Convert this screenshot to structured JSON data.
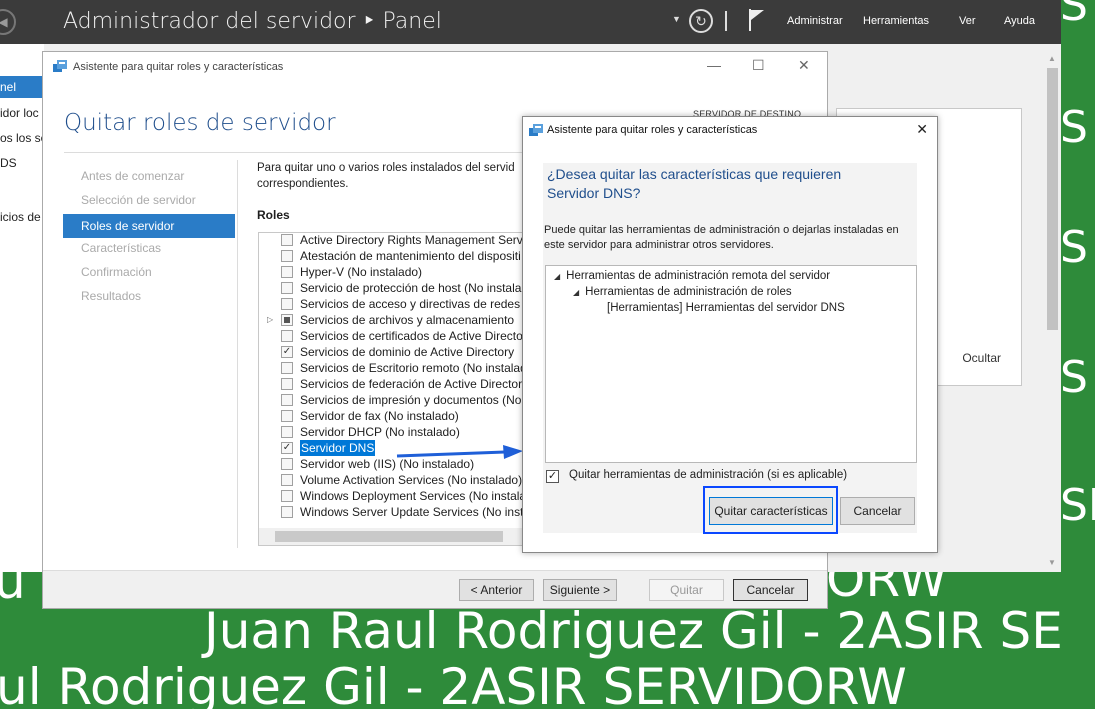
{
  "watermark": {
    "s_letter": "S",
    "se_text": "SE",
    "rw_text": "ORW",
    "ur_text": "u",
    "line1": "Juan Raul Rodriguez Gil - 2ASIR SE",
    "line2": "ul Rodriguez Gil - 2ASIR SERVIDORW"
  },
  "server_manager": {
    "breadcrumb": "Administrador del servidor ‣ Panel",
    "menu": [
      "Administrar",
      "Herramientas",
      "Ver",
      "Ayuda"
    ],
    "left_nav": [
      "nel",
      "idor loc",
      "os los se",
      "DS",
      "",
      "icios de"
    ],
    "tile_hide": "Ocultar"
  },
  "wizard": {
    "title": "Asistente para quitar roles y características",
    "dest_label": "SERVIDOR DE DESTINO",
    "heading": "Quitar roles de servidor",
    "steps": [
      "Antes de comenzar",
      "Selección de servidor",
      "Roles de servidor",
      "Características",
      "Confirmación",
      "Resultados"
    ],
    "intro_line1": "Para quitar uno o varios roles instalados del servid",
    "intro_line2": "correspondientes.",
    "roles_header": "Roles",
    "roles": [
      {
        "label": "Active Directory Rights Management Servi",
        "checked": false
      },
      {
        "label": "Atestación de mantenimiento del dispositi",
        "checked": false
      },
      {
        "label": "Hyper-V (No instalado)",
        "checked": false
      },
      {
        "label": "Servicio de protección de host (No instalad",
        "checked": false
      },
      {
        "label": "Servicios de acceso y directivas de redes (N",
        "checked": false
      },
      {
        "label": "Servicios de archivos y almacenamiento",
        "checked": "partial",
        "expandable": true
      },
      {
        "label": "Servicios de certificados de Active Director",
        "checked": false
      },
      {
        "label": "Servicios de dominio de Active Directory",
        "checked": true
      },
      {
        "label": "Servicios de Escritorio remoto (No instalad",
        "checked": false
      },
      {
        "label": "Servicios de federación de Active Directory",
        "checked": false
      },
      {
        "label": "Servicios de impresión y documentos (No",
        "checked": false
      },
      {
        "label": "Servidor de fax (No instalado)",
        "checked": false
      },
      {
        "label": "Servidor DHCP (No instalado)",
        "checked": false
      },
      {
        "label": "Servidor DNS",
        "checked": true,
        "selected": true
      },
      {
        "label": "Servidor web (IIS) (No instalado)",
        "checked": false
      },
      {
        "label": "Volume Activation Services (No instalado)",
        "checked": false
      },
      {
        "label": "Windows Deployment Services (No instala",
        "checked": false
      },
      {
        "label": "Windows Server Update Services (No insta",
        "checked": false
      }
    ],
    "buttons": {
      "prev": "< Anterior",
      "next": "Siguiente >",
      "remove": "Quitar",
      "cancel": "Cancelar"
    }
  },
  "dialog": {
    "title": "Asistente para quitar roles y características",
    "question": "¿Desea quitar las características que requieren Servidor DNS?",
    "description": "Puede quitar las herramientas de administración o dejarlas instaladas en este servidor para administrar otros servidores.",
    "tree": [
      "Herramientas de administración remota del servidor",
      "Herramientas de administración de roles",
      "[Herramientas] Herramientas del servidor DNS"
    ],
    "checkbox_label": "Quitar herramientas de administración (si es aplicable)",
    "checkbox_checked": true,
    "btn_remove": "Quitar características",
    "btn_cancel": "Cancelar"
  },
  "colors": {
    "desktop": "#2e8b3a",
    "accent": "#2a7cc7",
    "highlight": "#0a47ff",
    "heading": "#1f4e8c"
  }
}
